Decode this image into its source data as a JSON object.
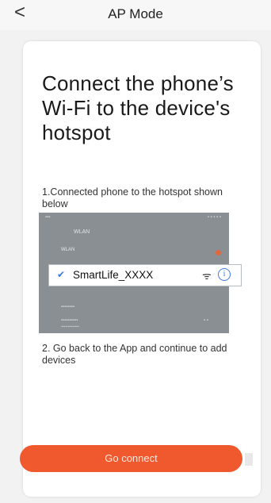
{
  "header": {
    "back_symbol": "<",
    "title": "AP Mode"
  },
  "card": {
    "heading": "Connect the phone’s Wi-Fi to the device's hotspot",
    "step1": "1.Connected phone to the hotspot shown below",
    "step2": "2. Go back to the App and continue to add devices"
  },
  "phone_screenshot": {
    "menu_title": "WLAN",
    "wlan_row_label": "WLAN",
    "ssid": "SmartLife_XXXX",
    "checkmark": "✔",
    "wifi_glyph": "ᯤ",
    "info_glyph": "i"
  },
  "buttons": {
    "go_connect": "Go connect"
  },
  "colors": {
    "accent": "#f0582d",
    "info_blue": "#3b7be0"
  }
}
